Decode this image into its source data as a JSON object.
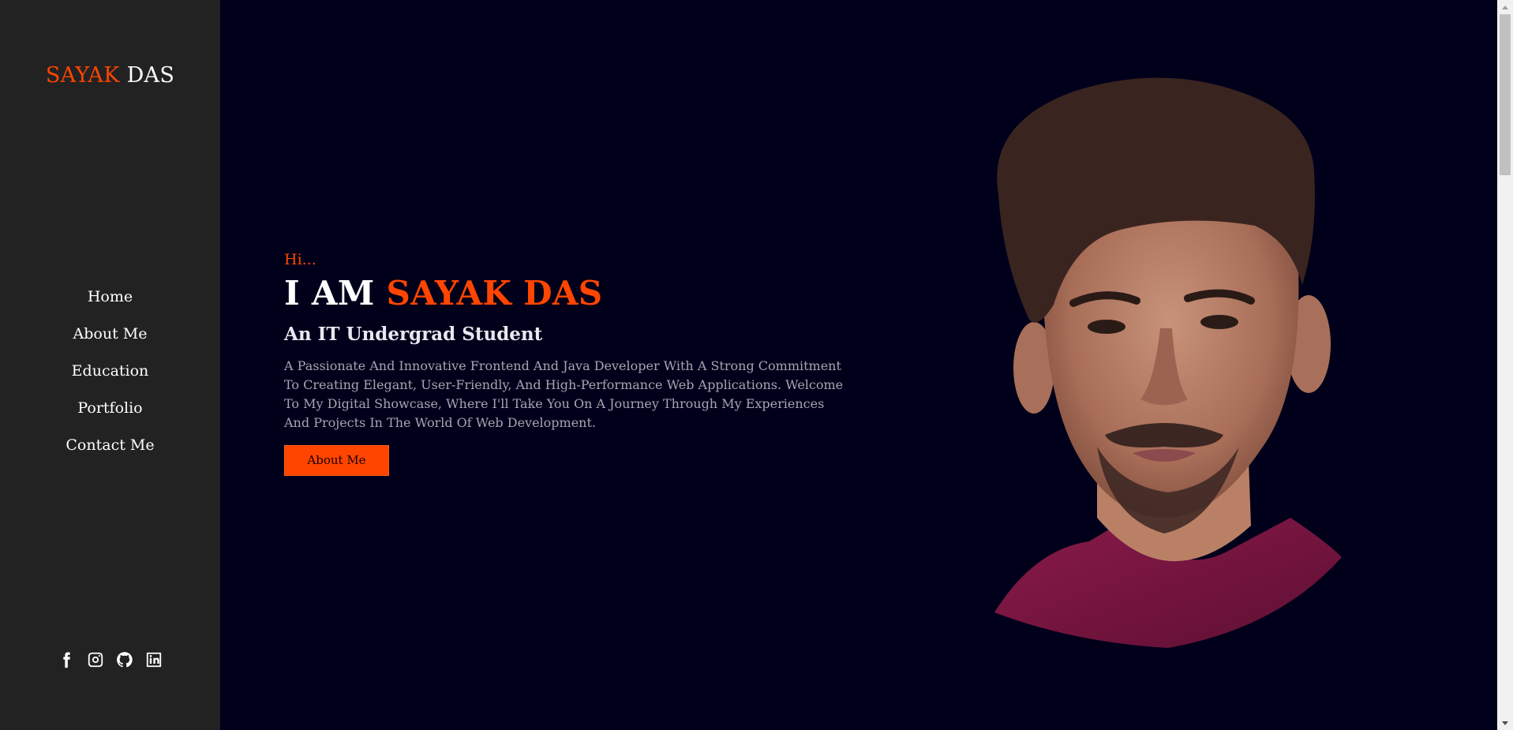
{
  "brand": {
    "first": "SAYAK",
    "last": "DAS"
  },
  "nav": {
    "items": [
      {
        "label": "Home"
      },
      {
        "label": "About Me"
      },
      {
        "label": "Education"
      },
      {
        "label": "Portfolio"
      },
      {
        "label": "Contact Me"
      }
    ]
  },
  "social": [
    "facebook-icon",
    "instagram-icon",
    "github-icon",
    "linkedin-icon"
  ],
  "hero": {
    "greeting": "Hi...",
    "headline_prefix": "I AM",
    "headline_name": "SAYAK DAS",
    "subtitle": "An IT Undergrad Student",
    "description": "A Passionate And Innovative Frontend And Java Developer With A Strong Commitment To Creating Elegant, User-Friendly, And High-Performance Web Applications. Welcome To My Digital Showcase, Where I'll Take You On A Journey Through My Experiences And Projects In The World Of Web Development.",
    "button_label": "About Me"
  },
  "colors": {
    "accent": "#ff4500",
    "sidebar_bg": "#222222",
    "main_bg": "#00001a"
  }
}
